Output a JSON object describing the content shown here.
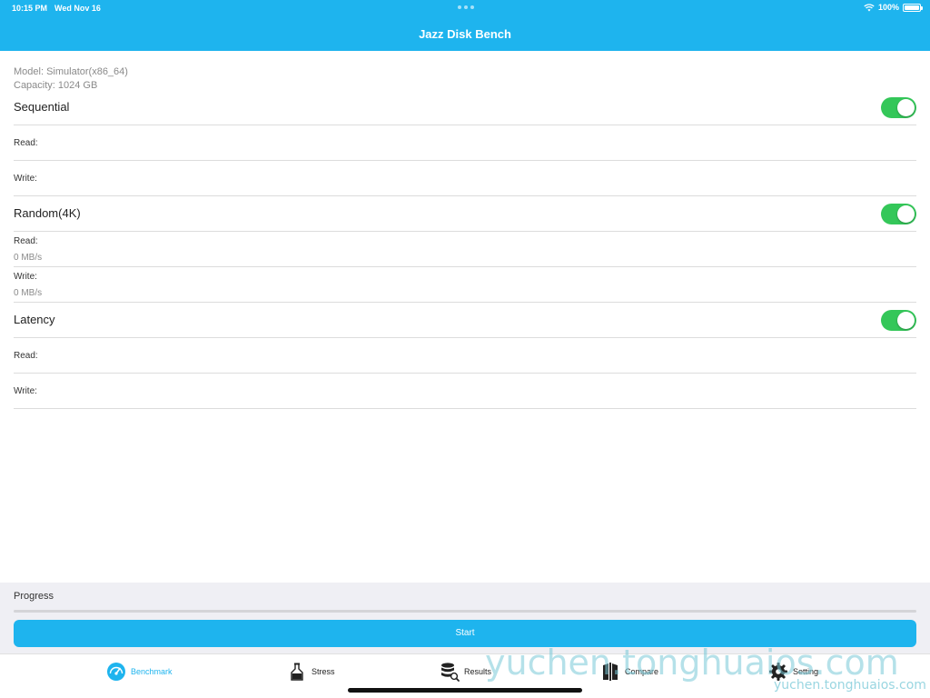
{
  "status_bar": {
    "time": "10:15 PM",
    "date": "Wed Nov 16",
    "battery": "100%"
  },
  "nav": {
    "title": "Jazz Disk Bench"
  },
  "device": {
    "model": "Model: Simulator(x86_64)",
    "capacity": "Capacity: 1024 GB"
  },
  "sections": {
    "sequential": {
      "title": "Sequential",
      "enabled": true,
      "read_label": "Read:",
      "write_label": "Write:"
    },
    "random": {
      "title": "Random(4K)",
      "enabled": true,
      "read_label": "Read:",
      "read_value": "0 MB/s",
      "write_label": "Write:",
      "write_value": "0 MB/s"
    },
    "latency": {
      "title": "Latency",
      "enabled": true,
      "read_label": "Read:",
      "write_label": "Write:"
    }
  },
  "progress": {
    "label": "Progress",
    "value": 0
  },
  "start_label": "Start",
  "tabs": [
    {
      "label": "Benchmark",
      "icon": "speedometer-icon",
      "active": true
    },
    {
      "label": "Stress",
      "icon": "flask-icon",
      "active": false
    },
    {
      "label": "Results",
      "icon": "database-search-icon",
      "active": false
    },
    {
      "label": "Compare",
      "icon": "compare-icon",
      "active": false
    },
    {
      "label": "Setting",
      "icon": "gear-icon",
      "active": false
    }
  ],
  "watermark": {
    "large": "yuchen.tonghuaios.com",
    "small": "yuchen.tonghuaios.com"
  },
  "colors": {
    "accent": "#1eb4ee",
    "toggle_on": "#34c759",
    "footer_bg": "#efeff4"
  }
}
